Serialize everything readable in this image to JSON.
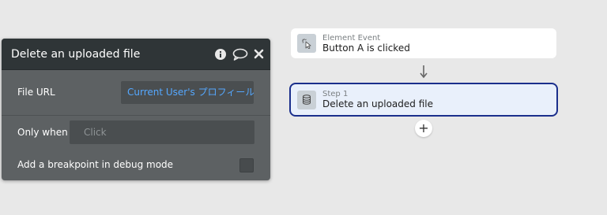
{
  "panel": {
    "title": "Delete an uploaded file",
    "header_icons": [
      "info-icon",
      "comment-icon",
      "close-icon"
    ],
    "file_url": {
      "label": "File URL",
      "value": "Current User's プロフィール"
    },
    "only_when": {
      "label": "Only when",
      "placeholder": "Click"
    },
    "breakpoint": {
      "label": "Add a breakpoint in debug mode",
      "checked": false
    }
  },
  "workflow": {
    "event_card": {
      "subtitle": "Element Event",
      "title": "Button A is clicked",
      "icon": "cursor-click-icon"
    },
    "step_card": {
      "subtitle": "Step 1",
      "title": "Delete an uploaded file",
      "icon": "database-icon",
      "selected": true
    },
    "add_button": "+"
  },
  "colors": {
    "canvas": "#e8e8e8",
    "panel_body": "#5d6163",
    "panel_header": "#2f3537",
    "link_blue": "#55a8ff",
    "selected_border": "#1b2f8c",
    "selected_fill": "#e9f0fb"
  }
}
